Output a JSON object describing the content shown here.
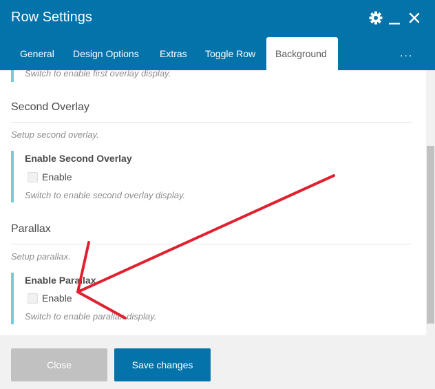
{
  "window": {
    "title": "Row Settings",
    "icons": {
      "settings": "gear-icon",
      "minimize": "minimize-icon",
      "close": "close-icon"
    }
  },
  "tabs": [
    {
      "label": "General",
      "active": false
    },
    {
      "label": "Design Options",
      "active": false
    },
    {
      "label": "Extras",
      "active": false
    },
    {
      "label": "Toggle Row",
      "active": false
    },
    {
      "label": "Background",
      "active": true
    }
  ],
  "tabs_more": "...",
  "content": {
    "top_help": "Switch to enable first overlay display.",
    "second_overlay": {
      "title": "Second Overlay",
      "description": "Setup second overlay.",
      "field_label": "Enable Second Overlay",
      "checkbox_label": "Enable",
      "checked": false,
      "help": "Switch to enable second overlay display."
    },
    "parallax": {
      "title": "Parallax",
      "description": "Setup parallax.",
      "field_label": "Enable Parallax",
      "checkbox_label": "Enable",
      "checked": false,
      "help": "Switch to enable parallax display."
    }
  },
  "footer": {
    "close_label": "Close",
    "save_label": "Save changes"
  },
  "colors": {
    "header_bg": "#0473aa",
    "accent": "#7ac8df",
    "close_button": "#c1c1c1",
    "save_button": "#0473aa",
    "annotation_arrow": "#e0202e"
  }
}
